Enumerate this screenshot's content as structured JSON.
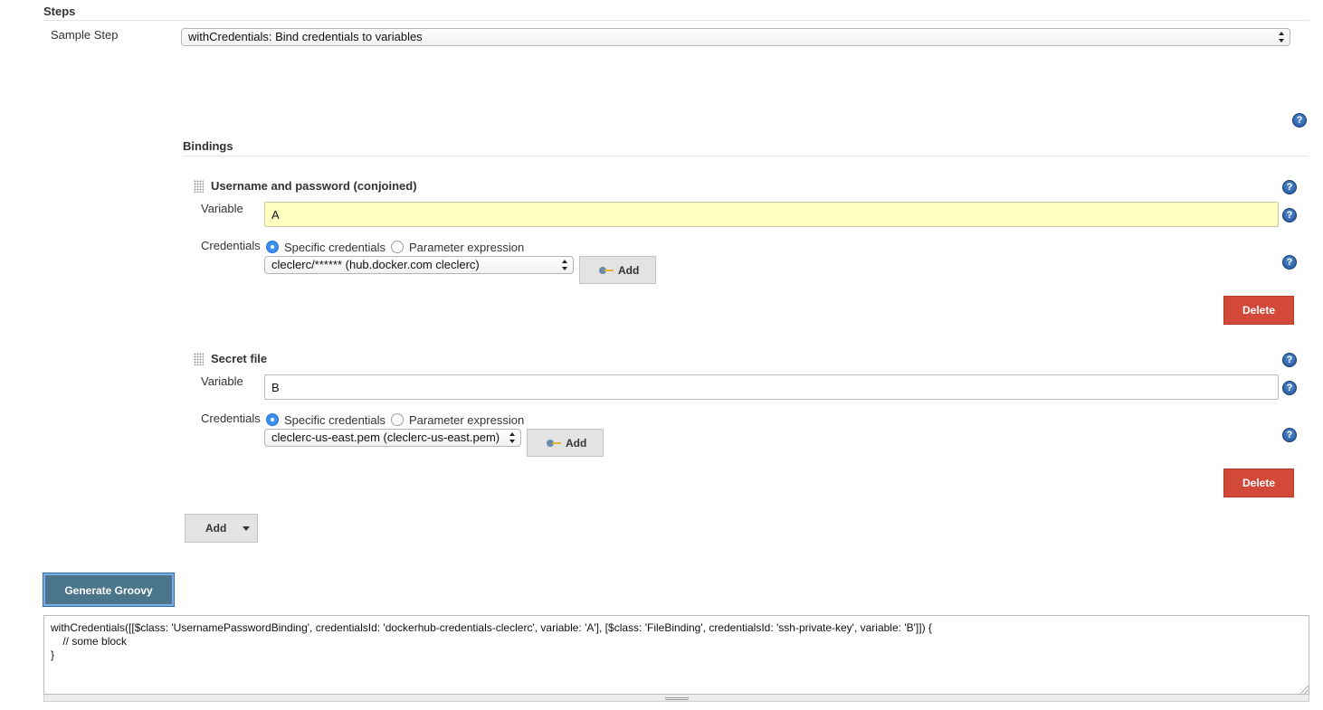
{
  "steps": {
    "title": "Steps",
    "sample_step_label": "Sample Step",
    "sample_step_value": "withCredentials: Bind credentials to variables"
  },
  "bindings": {
    "title": "Bindings",
    "items": [
      {
        "title": "Username and password (conjoined)",
        "variable_label": "Variable",
        "variable_value": "A",
        "credentials_label": "Credentials",
        "radio_specific": "Specific credentials",
        "radio_parameter": "Parameter expression",
        "selected_credential": "cleclerc/****** (hub.docker.com cleclerc)",
        "add_label": "Add",
        "delete_label": "Delete"
      },
      {
        "title": "Secret file",
        "variable_label": "Variable",
        "variable_value": "B",
        "credentials_label": "Credentials",
        "radio_specific": "Specific credentials",
        "radio_parameter": "Parameter expression",
        "selected_credential": "cleclerc-us-east.pem (cleclerc-us-east.pem)",
        "add_label": "Add",
        "delete_label": "Delete"
      }
    ],
    "add_binding_label": "Add"
  },
  "generate_button": "Generate Groovy",
  "groovy_output": "withCredentials([[$class: 'UsernamePasswordBinding', credentialsId: 'dockerhub-credentials-cleclerc', variable: 'A'], [$class: 'FileBinding', credentialsId: 'ssh-private-key', variable: 'B']]) {\n    // some block\n}",
  "help_glyph": "?",
  "icons": {
    "help": "help-icon",
    "key": "key-icon",
    "drag": "drag-handle-icon",
    "dropdown": "caret-down-icon"
  },
  "colors": {
    "delete_button": "#d24939",
    "generate_button": "#4b758b",
    "highlight_input": "#ffffc0",
    "help_icon": "#1c4f95",
    "radio_selected": "#3b8ff0"
  }
}
